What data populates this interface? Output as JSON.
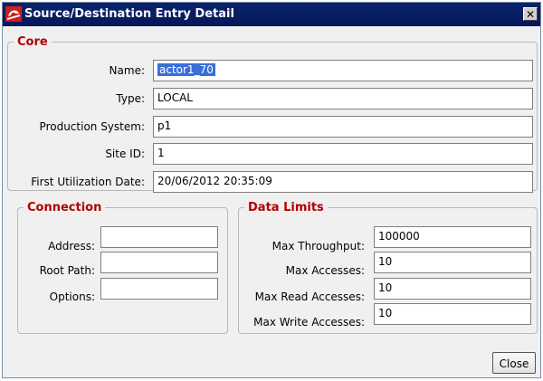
{
  "window": {
    "title": "Source/Destination Entry Detail",
    "close_glyph": "✕"
  },
  "core": {
    "legend": "Core",
    "name_label": "Name:",
    "name_value": "actor1_70",
    "type_label": "Type:",
    "type_value": "LOCAL",
    "production_label": "Production System:",
    "production_value": "p1",
    "site_label": "Site ID:",
    "site_value": "1",
    "first_util_label": "First Utilization Date:",
    "first_util_value": "20/06/2012 20:35:09"
  },
  "connection": {
    "legend": "Connection",
    "address_label": "Address:",
    "address_value": "",
    "root_label": "Root Path:",
    "root_value": "",
    "options_label": "Options:",
    "options_value": ""
  },
  "data_limits": {
    "legend": "Data Limits",
    "max_throughput_label": "Max Throughput:",
    "max_throughput_value": "100000",
    "max_accesses_label": "Max Accesses:",
    "max_accesses_value": "10",
    "max_read_label": "Max Read Accesses:",
    "max_read_value": "10",
    "max_write_label": "Max Write Accesses:",
    "max_write_value": "10"
  },
  "buttons": {
    "close_label": "Close"
  },
  "colors": {
    "legend_text": "#b00000",
    "titlebar": "#0a246a",
    "selection": "#3a6fd8"
  },
  "icons": {
    "app": "app-logo-icon",
    "window_close": "close-icon"
  }
}
